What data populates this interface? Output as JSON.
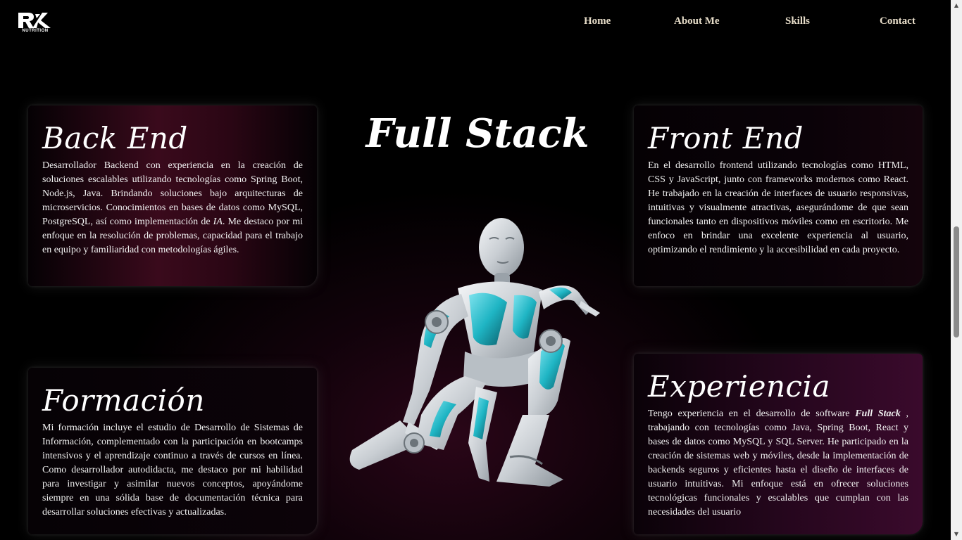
{
  "navbar": {
    "logo_text": "NUTRITION",
    "links": [
      "Home",
      "About Me",
      "Skills",
      "Contact"
    ]
  },
  "center": {
    "title": "Full Stack"
  },
  "cards": {
    "backend": {
      "title": "Back End",
      "body_1": "Desarrollador Backend con experiencia en la creación de soluciones escalables utilizando tecnologías como Spring Boot, Node.js, Java. Brindando soluciones bajo arquitecturas de microservicios. Conocimientos en bases de datos como MySQL, PostgreSQL, así como implementación de ",
      "body_em": "IA",
      "body_2": ". Me destaco por mi enfoque en la resolución de problemas, capacidad para el trabajo en equipo y familiaridad con metodologías ágiles."
    },
    "frontend": {
      "title": "Front End",
      "body": "En el desarrollo frontend utilizando tecnologías como HTML, CSS y JavaScript, junto con frameworks modernos como React. He trabajado en la creación de interfaces de usuario responsivas, intuitivas y visualmente atractivas, asegurándome de que sean funcionales tanto en dispositivos móviles como en escritorio. Me enfoco en brindar una excelente experiencia al usuario, optimizando el rendimiento y la accesibilidad en cada proyecto."
    },
    "formacion": {
      "title": "Formación",
      "body": "Mi formación incluye el estudio de Desarrollo de Sistemas de Información, complementado con la participación en bootcamps intensivos y el aprendizaje continuo a través de cursos en línea. Como desarrollador autodidacta, me destaco por mi habilidad para investigar y asimilar nuevos conceptos, apoyándome siempre en una sólida base de documentación técnica para desarrollar soluciones efectivas y actualizadas."
    },
    "experiencia": {
      "title": "Experiencia",
      "body_1": "Tengo experiencia en el desarrollo de software ",
      "body_strong": "Full Stack",
      "body_2": " , trabajando con tecnologías como Java, Spring Boot, React y bases de datos como MySQL y SQL Server. He participado en la creación de sistemas web y móviles, desde la implementación de backends seguros y eficientes hasta el diseño de interfaces de usuario intuitivas. Mi enfoque está en ofrecer soluciones tecnológicas funcionales y escalables que cumplan con las necesidades del usuario"
    }
  },
  "colors": {
    "background": "#000000",
    "accent_magenta": "#3a0a1c",
    "nav_text": "#e6dcc8",
    "robot_accent": "#1fb5c4"
  },
  "icons": {
    "logo": "rk-logo-icon",
    "robot": "robot-illustration",
    "scroll_up": "triangle-up-icon",
    "scroll_down": "triangle-down-icon"
  }
}
